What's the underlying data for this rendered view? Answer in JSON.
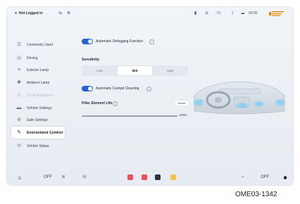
{
  "status_bar": {
    "profile": "Not Logged in",
    "time": "00:00",
    "icons": [
      "person-icon",
      "shield-icon",
      "lock-icon",
      "phone-icon",
      "signal-icon",
      "bluetooth-icon",
      "cloud-icon",
      "brand-logo"
    ]
  },
  "sidebar": {
    "items": [
      {
        "label": "Commonly Used",
        "icon": "star-icon"
      },
      {
        "label": "Driving",
        "icon": "steering-icon"
      },
      {
        "label": "Exterior Lamp",
        "icon": "headlamp-icon"
      },
      {
        "label": "Ambient Lamp",
        "icon": "bulb-icon"
      },
      {
        "label": "Driver Assistance",
        "icon": "assist-icon"
      },
      {
        "label": "Vehicle Settings",
        "icon": "car-icon"
      },
      {
        "label": "Safe Settings",
        "icon": "safety-icon"
      },
      {
        "label": "Environment Comfort",
        "icon": "fan-icon"
      },
      {
        "label": "Vehicle Status",
        "icon": "status-icon"
      }
    ],
    "active_index": 7,
    "disabled_index": 4
  },
  "settings": {
    "defogging": {
      "label": "Automatic Defogging Function",
      "on": true
    },
    "sensitivity": {
      "label": "Sensitivity",
      "options": [
        "Low",
        "Mid",
        "High"
      ],
      "selected": "Mid"
    },
    "cockpit_clean": {
      "label": "Automatic Cockpit Cleaning",
      "on": true
    },
    "filter": {
      "label": "Filter Element Life",
      "reset_label": "Reset",
      "value_text": "100%",
      "value": 1.0
    }
  },
  "bottom_bar": {
    "left_temp": "OFF",
    "right_temp": "OFF"
  },
  "caption": "OME03-1342",
  "colors": {
    "accent": "#2463d6",
    "toggle_on": "#2463d6",
    "active_item_bg": "#ffffff"
  }
}
